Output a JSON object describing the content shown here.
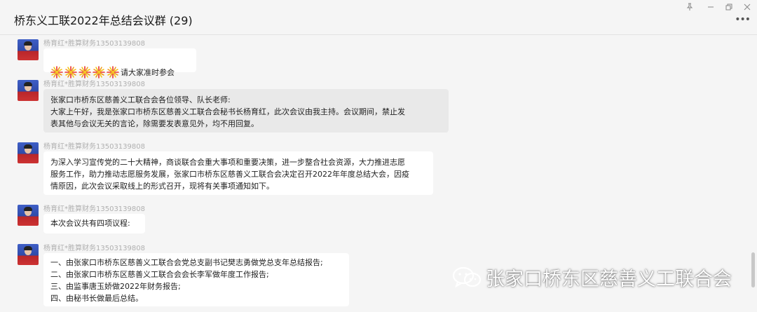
{
  "window": {
    "title": "桥东义工联2022年总结会议群 (29)",
    "controls": [
      "pin-icon",
      "minimize-icon",
      "restore-icon",
      "close-icon"
    ],
    "more_label": "•••"
  },
  "messages": [
    {
      "sender": "杨育红*胜算财务13503139808",
      "fireworks": 5,
      "text": "请大家准时参会"
    },
    {
      "sender": "杨育红*胜算财务13503139808",
      "text": "张家口市桥东区慈善义工联合会各位领导、队长老师:\n大家上午好，我是张家口市桥东区慈善义工联合会秘书长杨育红，此次会议由我主持。会议期间，禁止发\n表其他与会议无关的言论，除需要发表意见外，均不用回复。"
    },
    {
      "sender": "杨育红*胜算财务13503139808",
      "text": "为深入学习宣传党的二十大精神，商谈联合会重大事项和重要决策，进一步整合社会资源，大力推进志愿\n服务工作，助力推动志愿服务发展，张家口市桥东区慈善义工联合会决定召开2022年年度总结大会，因疫\n情原因，此次会议采取线上的形式召开，现将有关事项通知如下。"
    },
    {
      "sender": "杨育红*胜算财务13503139808",
      "text": "本次会议共有四项议程:"
    },
    {
      "sender": "杨育红*胜算财务13503139808",
      "text": "一、由张家口市桥东区慈善义工联合会党总支副书记樊志勇做党总支年总结报告;\n二、由张家口市桥东区慈善义工联合会会长李军做年度工作报告;\n三、由监事唐玉娇做2022年财务报告;\n四、由秘书长做最后总结。"
    }
  ],
  "watermark": {
    "text": "张家口桥东区慈善义工联合会"
  }
}
